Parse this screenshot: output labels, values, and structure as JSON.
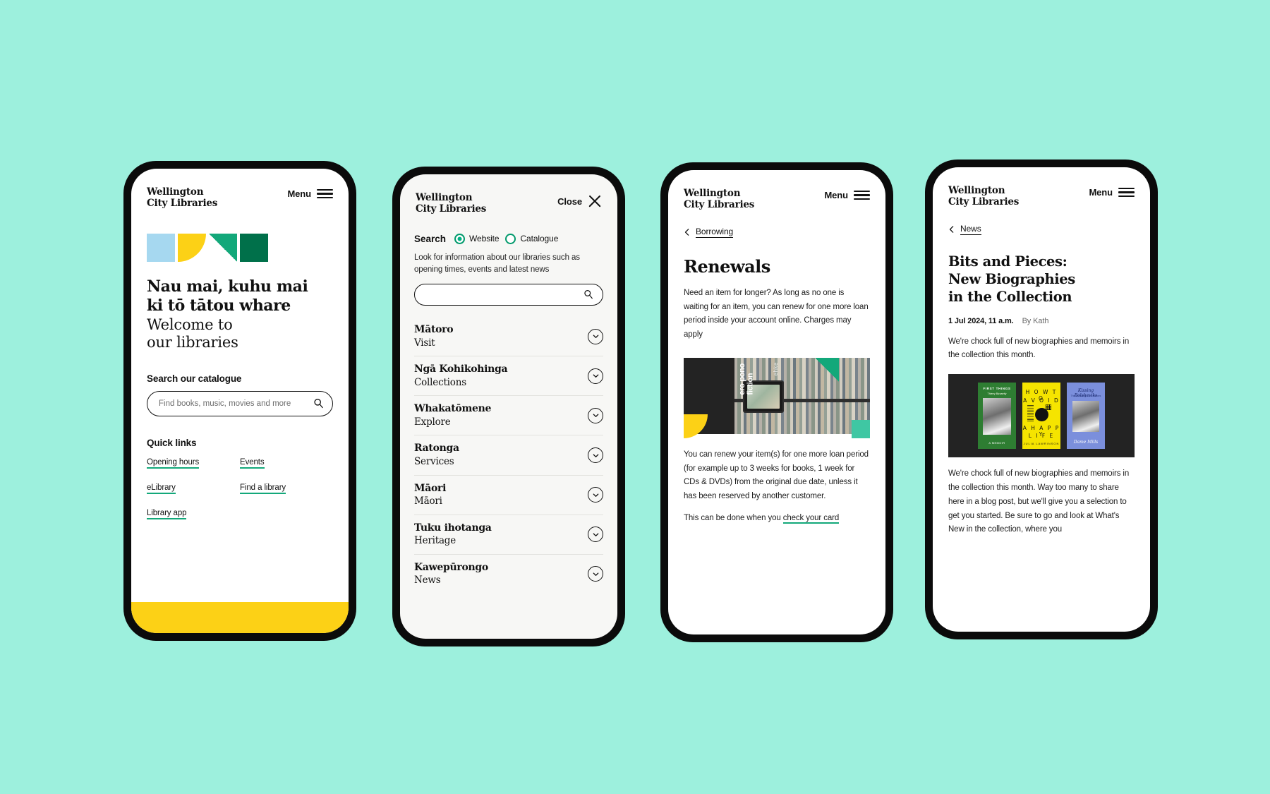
{
  "page": {
    "background_color": "#9df0dd"
  },
  "brand": {
    "wordmark": "Wellington\nCity Libraries",
    "accent_green": "#13a87a",
    "accent_dark_green": "#00704a",
    "accent_yellow": "#fcd116",
    "accent_blue": "#a6d8f0"
  },
  "phone1": {
    "header": {
      "menu_label": "Menu",
      "icon": "hamburger-icon"
    },
    "hero": {
      "maori": "Nau mai, kuhu mai\nki tō tātou whare",
      "english": "Welcome to\nour libraries"
    },
    "catalogue": {
      "label": "Search our catalogue",
      "placeholder": "Find books, music, movies and more",
      "value": "",
      "icon": "search-icon"
    },
    "quick_links": {
      "label": "Quick links",
      "items": [
        {
          "label": "Opening hours"
        },
        {
          "label": "Events"
        },
        {
          "label": "eLibrary"
        },
        {
          "label": "Find a library"
        },
        {
          "label": "Library app"
        }
      ]
    }
  },
  "phone2": {
    "header": {
      "close_label": "Close",
      "icon": "close-icon"
    },
    "search": {
      "label": "Search",
      "options": [
        {
          "label": "Website",
          "selected": true
        },
        {
          "label": "Catalogue",
          "selected": false
        }
      ],
      "help": "Look for information about our libraries such as\nopening times, events and latest news",
      "placeholder": "",
      "value": "",
      "icon": "search-icon"
    },
    "menu_items": [
      {
        "maori": "Mātoro",
        "english": "Visit"
      },
      {
        "maori": "Ngā Kohikohinga",
        "english": "Collections"
      },
      {
        "maori": "Whakatōmene",
        "english": "Explore"
      },
      {
        "maori": "Ratonga",
        "english": "Services"
      },
      {
        "maori": "Māori",
        "english": "Māori"
      },
      {
        "maori": "Tuku ihotanga",
        "english": "Heritage"
      },
      {
        "maori": "Kawepūrongo",
        "english": "News"
      }
    ],
    "expand_icon": "chevron-down-icon"
  },
  "phone3": {
    "header": {
      "menu_label": "Menu",
      "icon": "hamburger-icon"
    },
    "breadcrumb": {
      "label": "Borrowing",
      "icon": "chevron-left-icon"
    },
    "title": "Renewals",
    "intro": "Need an item for longer? As long as no one is waiting for an item, you can renew for one more loan period inside your account online. Charges may apply",
    "photo": {
      "caption_vertical": "ero pono\nfiction",
      "caption_vertical_small": "ehke"
    },
    "body": "You can renew your item(s) for one more loan period (for example up to 3 weeks for books, 1 week for CDs & DVDs) from the original due date, unless it has been reserved by another customer.",
    "footer_text_before": "This can be done when you ",
    "footer_link": "check your card"
  },
  "phone4": {
    "header": {
      "menu_label": "Menu",
      "icon": "hamburger-icon"
    },
    "breadcrumb": {
      "label": "News",
      "icon": "chevron-left-icon"
    },
    "title": "Bits and Pieces:\nNew Biographies\nin the Collection",
    "date": "1 Jul 2024, 11 a.m.",
    "author": "By Kath",
    "standfirst": "We're chock full of new biographies and memoirs in the collection this month.",
    "covers": [
      {
        "title": "FIRST THINGS",
        "author": "Thierry Bizzarrity",
        "footer": "A MEMOIR",
        "color": "#2e7d32"
      },
      {
        "line1": "H O W  T O",
        "line2": "A V O I D",
        "line3": "A  H A P P Y",
        "line4": "L I F E",
        "author": "JULIA LAWRINSON",
        "color": "#f5e400"
      },
      {
        "title": "Kissing Bolsheviks",
        "subtitle": "The Vanishing Act of Heroes",
        "author": "Dame Mills",
        "color": "#7b8fdc"
      }
    ],
    "body": "We're chock full of new biographies and memoirs in the collection this month.  Way too many to share here in a blog post, but we'll give you a selection to get you started.  Be sure to go and look at What's New in the collection, where you"
  }
}
